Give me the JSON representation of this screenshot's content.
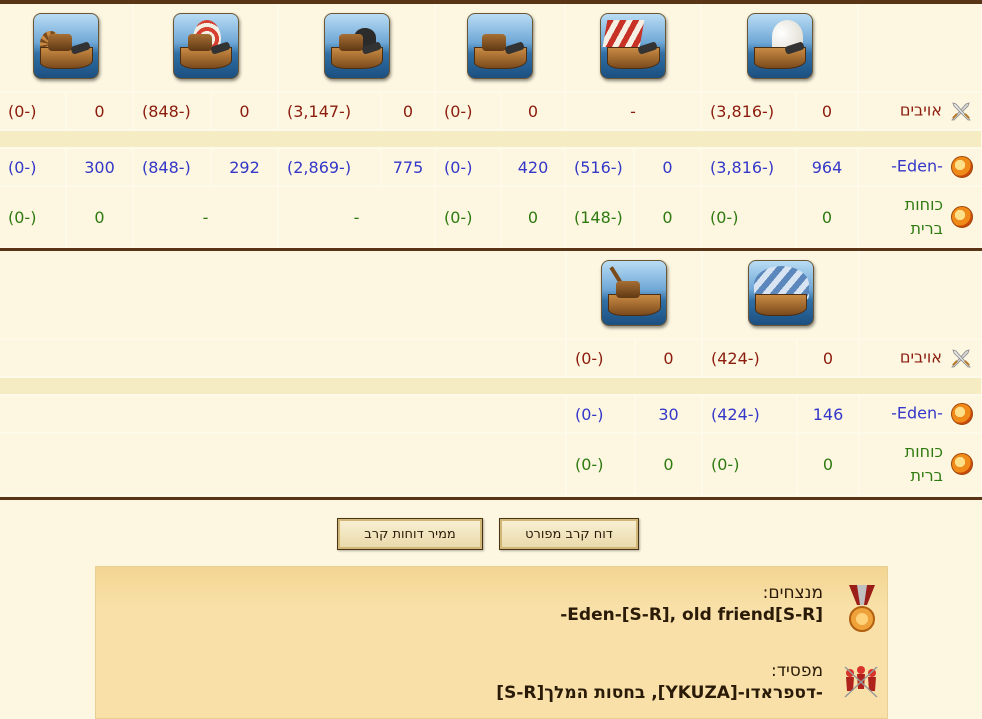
{
  "battle_tables": [
    {
      "units": [
        "cannon-ship-icon",
        "mortar-ship-icon",
        "paddle-ship-icon",
        "ballista-ship-icon",
        "striped-sail-ship-icon",
        "sail-ram-ship-icon"
      ],
      "rows": [
        {
          "side": "enemies",
          "label": "אויבים",
          "color": "#8b1c0e",
          "cells": [
            "(0-)",
            "0",
            "(848-)",
            "0",
            "(3,147-)",
            "0",
            "(0-)",
            "0",
            "-",
            "(3,816-)",
            "0"
          ]
        },
        {
          "side": "own",
          "label": "-Eden-",
          "color": "#3437c8",
          "cells": [
            "(0-)",
            "300",
            "(848-)",
            "292",
            "(2,869-)",
            "775",
            "(0-)",
            "420",
            "(516-)",
            "0",
            "(3,816-)",
            "964"
          ]
        },
        {
          "side": "allies",
          "label": "כוחות ברית",
          "color": "#2f7a10",
          "cells": [
            "(0-)",
            "0",
            "-",
            "-",
            "(0-)",
            "0",
            "(148-)",
            "0",
            "(0-)",
            "0"
          ]
        }
      ]
    },
    {
      "units": [
        "crane-ship-icon",
        "balloon-carrier-icon"
      ],
      "rows": [
        {
          "side": "enemies",
          "label": "אויבים",
          "cells": [
            "(0-)",
            "0",
            "(424-)",
            "0"
          ]
        },
        {
          "side": "own",
          "label": "-Eden-",
          "cells": [
            "(0-)",
            "30",
            "(424-)",
            "146"
          ]
        },
        {
          "side": "allies",
          "label": "כוחות ברית",
          "cells": [
            "(0-)",
            "0",
            "(0-)",
            "0"
          ]
        }
      ]
    }
  ],
  "buttons": {
    "detailed_report": "דוח קרב מפורט",
    "convert_reports": "ממיר דוחות קרב"
  },
  "result": {
    "winners_title": "מנצחים:",
    "winners_names": "Eden-[S-R], old friend[S-R]-",
    "loser_title": "מפסיד:",
    "loser_names": "-דספראדו-[YKUZA], בחסות המלך[S-R]"
  },
  "colors": {
    "enemy_text": "#8b1c0e",
    "own_text": "#3437c8",
    "ally_text": "#2f7a10",
    "frame_brown": "#5a3515",
    "result_box_bg": "#f8e0a8"
  }
}
